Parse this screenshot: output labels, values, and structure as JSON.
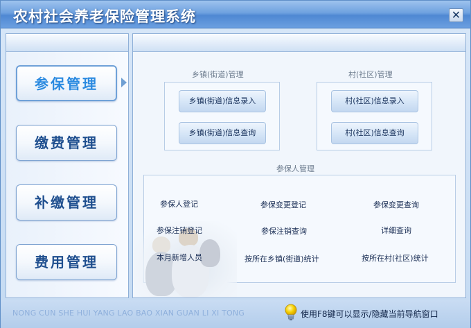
{
  "window": {
    "title": "农村社会养老保险管理系统",
    "close_label": "✕"
  },
  "nav": {
    "items": [
      {
        "label": "参保管理",
        "active": true
      },
      {
        "label": "缴费管理",
        "active": false
      },
      {
        "label": "补缴管理",
        "active": false
      },
      {
        "label": "费用管理",
        "active": false
      }
    ]
  },
  "main": {
    "township_group": {
      "title": "乡镇(街道)管理",
      "buttons": [
        "乡镇(街道)信息录入",
        "乡镇(街道)信息查询"
      ]
    },
    "village_group": {
      "title": "村(社区)管理",
      "buttons": [
        "村(社区)信息录入",
        "村(社区)信息查询"
      ]
    },
    "insured_group": {
      "title": "参保人管理",
      "links": [
        "参保人登记",
        "参保变更登记",
        "参保变更查询",
        "参保注销登记",
        "参保注销查询",
        "详细查询",
        "本月新增人员",
        "按所在乡镇(街道)统计",
        "按所在村(社区)统计"
      ]
    }
  },
  "footer": {
    "pinyin": "NONG CUN SHE HUI YANG LAO BAO XIAN GUAN LI XI TONG",
    "hint": "使用F8键可以显示/隐藏当前导航窗口"
  },
  "colors": {
    "accent": "#2b8ae0",
    "nav_text": "#1f4f8f",
    "title_bar": "#4f88d3"
  }
}
